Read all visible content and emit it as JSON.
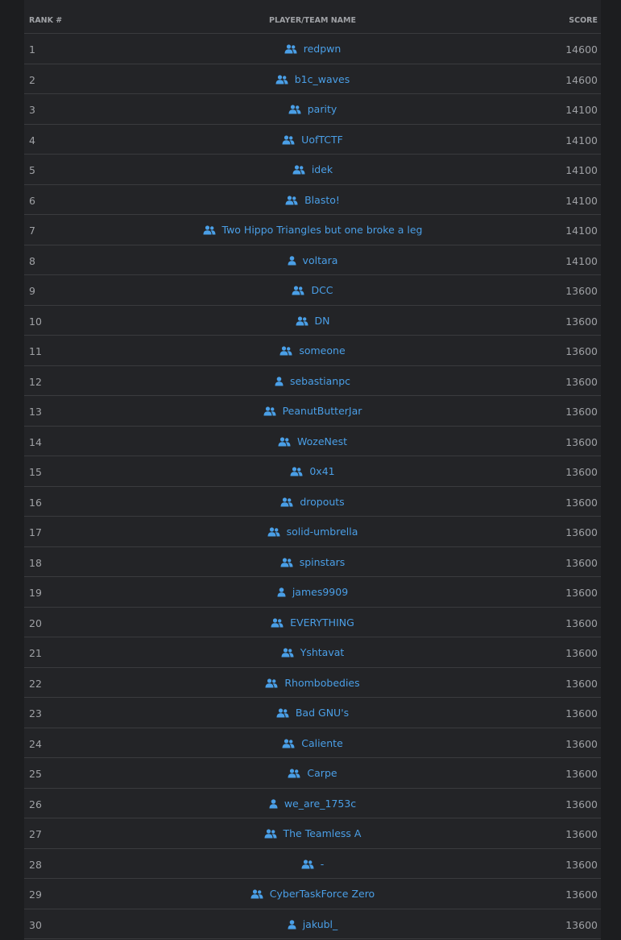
{
  "colors": {
    "background": "#1c1d1f",
    "panel": "#232427",
    "divider": "#3a3b3e",
    "link": "#4a9fe7",
    "muted_text": "#9fa1a5"
  },
  "table": {
    "headers": {
      "rank": "RANK #",
      "name": "PLAYER/TEAM NAME",
      "score": "SCORE"
    },
    "rows": [
      {
        "rank": "1",
        "name": "redpwn",
        "icon": "team-icon",
        "score": "14600"
      },
      {
        "rank": "2",
        "name": "b1c_waves",
        "icon": "team-icon",
        "score": "14600"
      },
      {
        "rank": "3",
        "name": "parity",
        "icon": "team-icon",
        "score": "14100"
      },
      {
        "rank": "4",
        "name": "UofTCTF",
        "icon": "team-icon",
        "score": "14100"
      },
      {
        "rank": "5",
        "name": "idek",
        "icon": "team-icon",
        "score": "14100"
      },
      {
        "rank": "6",
        "name": "Blasto!",
        "icon": "team-icon",
        "score": "14100"
      },
      {
        "rank": "7",
        "name": "Two Hippo Triangles but one broke a leg",
        "icon": "team-icon",
        "score": "14100"
      },
      {
        "rank": "8",
        "name": "voltara",
        "icon": "user-icon",
        "score": "14100"
      },
      {
        "rank": "9",
        "name": "DCC",
        "icon": "team-icon",
        "score": "13600"
      },
      {
        "rank": "10",
        "name": "DN",
        "icon": "team-icon",
        "score": "13600"
      },
      {
        "rank": "11",
        "name": "someone",
        "icon": "team-icon",
        "score": "13600"
      },
      {
        "rank": "12",
        "name": "sebastianpc",
        "icon": "user-icon",
        "score": "13600"
      },
      {
        "rank": "13",
        "name": "PeanutButterJar",
        "icon": "team-icon",
        "score": "13600"
      },
      {
        "rank": "14",
        "name": "WozeNest",
        "icon": "team-icon",
        "score": "13600"
      },
      {
        "rank": "15",
        "name": "0x41",
        "icon": "team-icon",
        "score": "13600"
      },
      {
        "rank": "16",
        "name": "dropouts",
        "icon": "team-icon",
        "score": "13600"
      },
      {
        "rank": "17",
        "name": "solid-umbrella",
        "icon": "team-icon",
        "score": "13600"
      },
      {
        "rank": "18",
        "name": "spinstars",
        "icon": "team-icon",
        "score": "13600"
      },
      {
        "rank": "19",
        "name": "james9909",
        "icon": "user-icon",
        "score": "13600"
      },
      {
        "rank": "20",
        "name": "EVERYTHING",
        "icon": "team-icon",
        "score": "13600"
      },
      {
        "rank": "21",
        "name": "Yshtavat",
        "icon": "team-icon",
        "score": "13600"
      },
      {
        "rank": "22",
        "name": "Rhombobedies",
        "icon": "team-icon",
        "score": "13600"
      },
      {
        "rank": "23",
        "name": "Bad GNU's",
        "icon": "team-icon",
        "score": "13600"
      },
      {
        "rank": "24",
        "name": "Caliente",
        "icon": "team-icon",
        "score": "13600"
      },
      {
        "rank": "25",
        "name": "Carpe",
        "icon": "team-icon",
        "score": "13600"
      },
      {
        "rank": "26",
        "name": "we_are_1753c",
        "icon": "user-icon",
        "score": "13600"
      },
      {
        "rank": "27",
        "name": "The Teamless A",
        "icon": "team-icon",
        "score": "13600"
      },
      {
        "rank": "28",
        "name": "-",
        "icon": "team-icon",
        "score": "13600"
      },
      {
        "rank": "29",
        "name": "CyberTaskForce Zero",
        "icon": "team-icon",
        "score": "13600"
      },
      {
        "rank": "30",
        "name": "jakubl_",
        "icon": "user-icon",
        "score": "13600"
      }
    ]
  }
}
